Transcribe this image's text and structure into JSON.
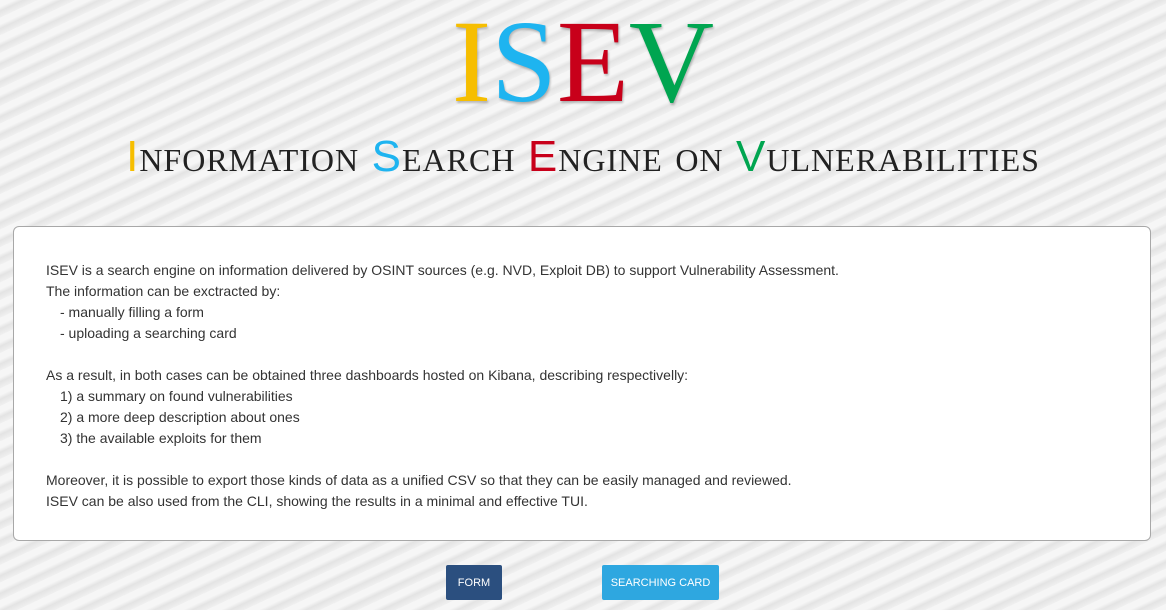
{
  "logo": {
    "letters": [
      {
        "char": "I",
        "color": "#f6be00"
      },
      {
        "char": "S",
        "color": "#1eb4f0"
      },
      {
        "char": "E",
        "color": "#c8001a"
      },
      {
        "char": "V",
        "color": "#00a550"
      }
    ]
  },
  "subtitle": {
    "words": [
      {
        "cap": "I",
        "cap_color": "#f6be00",
        "rest": "nformation "
      },
      {
        "cap": "S",
        "cap_color": "#1eb4f0",
        "rest": "earch "
      },
      {
        "cap": "E",
        "cap_color": "#c8001a",
        "rest": "ngine on "
      },
      {
        "cap": "V",
        "cap_color": "#00a550",
        "rest": "ulnerabilities"
      }
    ]
  },
  "description": {
    "line1": "ISEV is a search engine on information delivered by OSINT sources (e.g. NVD, Exploit DB) to support Vulnerability Assessment.",
    "line2": "The information can be exctracted by:",
    "line3": "- manually filling a form",
    "line4": "- uploading a searching card",
    "line5": "As a result, in both cases can be obtained three dashboards hosted on Kibana, describing respectivelly:",
    "line6": "1) a summary on found vulnerabilities",
    "line7": "2) a more deep description about ones",
    "line8": "3) the available exploits for them",
    "line9": "Moreover, it is possible to export those kinds of data as a unified CSV so that they can be easily managed and reviewed.",
    "line10": "ISEV can be also used from the CLI, showing the results in a minimal and effective TUI."
  },
  "buttons": {
    "form_label": "Form",
    "searching_card_label": "Searching card"
  }
}
